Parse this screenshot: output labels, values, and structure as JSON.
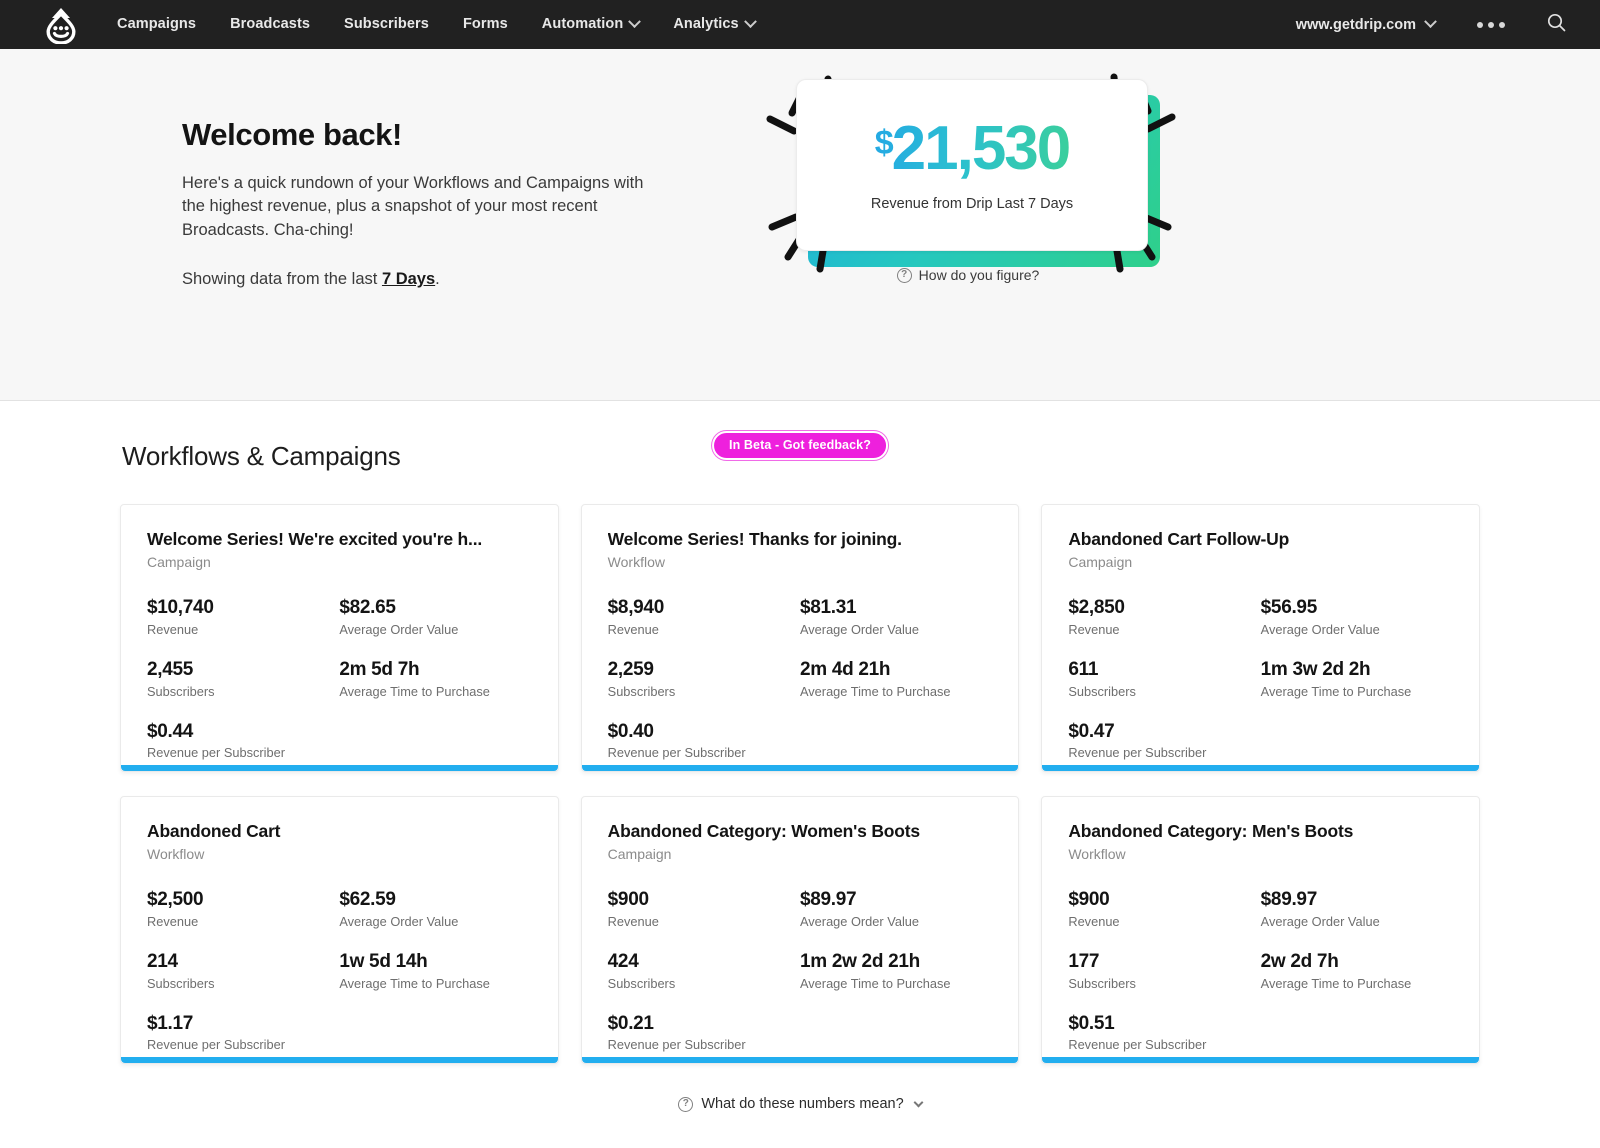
{
  "nav": {
    "logo_name": "drip-logo",
    "links": [
      {
        "label": "Campaigns",
        "has_caret": false
      },
      {
        "label": "Broadcasts",
        "has_caret": false
      },
      {
        "label": "Subscribers",
        "has_caret": false
      },
      {
        "label": "Forms",
        "has_caret": false
      },
      {
        "label": "Automation",
        "has_caret": true
      },
      {
        "label": "Analytics",
        "has_caret": true
      }
    ],
    "account": "www.getdrip.com",
    "more_label": "more-menu",
    "search_label": "search"
  },
  "hero": {
    "title": "Welcome back!",
    "body": "Here's a quick rundown of your Workflows and Campaigns with the highest revenue, plus a snapshot of your most recent Broadcasts. Cha-ching!",
    "showing_prefix": "Showing data from the last ",
    "showing_range": "7 Days",
    "showing_suffix": ".",
    "revenue": {
      "currency": "$",
      "amount": "21,530",
      "caption": "Revenue from Drip Last 7 Days",
      "help_link": "How do you figure?"
    }
  },
  "beta_badge": "In Beta - Got feedback?",
  "main": {
    "section_title": "Workflows & Campaigns",
    "footer_link": "What do these numbers mean?",
    "labels": {
      "revenue": "Revenue",
      "aov": "Average Order Value",
      "subscribers": "Subscribers",
      "attp": "Average Time to Purchase",
      "rps": "Revenue per Subscriber"
    },
    "cards": [
      {
        "title": "Welcome Series! We're excited you're h...",
        "type": "Campaign",
        "revenue": "$10,740",
        "aov": "$82.65",
        "subscribers": "2,455",
        "attp": "2m 5d 7h",
        "rps": "$0.44"
      },
      {
        "title": "Welcome Series! Thanks for joining.",
        "type": "Workflow",
        "revenue": "$8,940",
        "aov": "$81.31",
        "subscribers": "2,259",
        "attp": "2m 4d 21h",
        "rps": "$0.40"
      },
      {
        "title": "Abandoned Cart Follow-Up",
        "type": "Campaign",
        "revenue": "$2,850",
        "aov": "$56.95",
        "subscribers": "611",
        "attp": "1m 3w 2d 2h",
        "rps": "$0.47"
      },
      {
        "title": "Abandoned Cart",
        "type": "Workflow",
        "revenue": "$2,500",
        "aov": "$62.59",
        "subscribers": "214",
        "attp": "1w 5d 14h",
        "rps": "$1.17"
      },
      {
        "title": "Abandoned Category: Women's Boots",
        "type": "Campaign",
        "revenue": "$900",
        "aov": "$89.97",
        "subscribers": "424",
        "attp": "1m 2w 2d 21h",
        "rps": "$0.21"
      },
      {
        "title": "Abandoned Category: Men's Boots",
        "type": "Workflow",
        "revenue": "$900",
        "aov": "$89.97",
        "subscribers": "177",
        "attp": "2w 2d 7h",
        "rps": "$0.51"
      }
    ]
  },
  "colors": {
    "nav_bg": "#212121",
    "accent_blue": "#22aeef",
    "gradient_start": "#24a9e4",
    "gradient_end": "#3bcf9c",
    "beta_pink": "#ee20dd",
    "hero_bg": "#f7f7f7"
  }
}
